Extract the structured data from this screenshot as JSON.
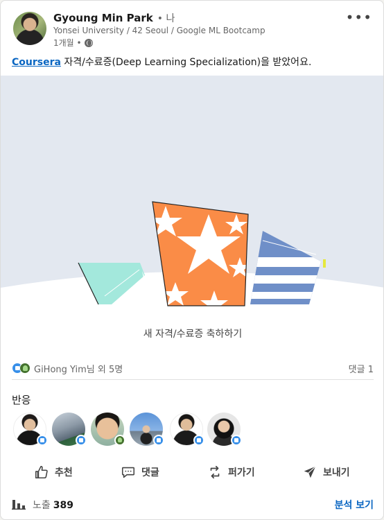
{
  "post": {
    "author": {
      "name": "Gyoung Min Park",
      "degree": "• 나",
      "headline": "Yonsei University / 42 Seoul / Google ML Bootcamp",
      "time": "1개월 •",
      "visibility_icon": "globe-icon"
    },
    "more_icon": "more-horizontal-icon",
    "more_label": "•••",
    "text": {
      "link": "Coursera",
      "rest": " 자격/수료증(Deep Learning Specialization)을 받았어요."
    }
  },
  "banner": {
    "caption": "새 자격/수료증 축하하기",
    "colors": {
      "background": "#e3e8f0",
      "orange": "#fa8c47",
      "teal": "#a3e8dc",
      "blue": "#6f8fc8",
      "yellow": "#e5e83d"
    }
  },
  "social": {
    "names": "GiHong Yim님 외 5명",
    "comments": "댓글 1",
    "icons": [
      "like-icon",
      "celebrate-icon"
    ]
  },
  "reactions": {
    "label": "반응",
    "people": [
      {
        "name": "reactor-1",
        "reaction": "like"
      },
      {
        "name": "reactor-2",
        "reaction": "like"
      },
      {
        "name": "reactor-3",
        "reaction": "celebrate"
      },
      {
        "name": "reactor-4",
        "reaction": "like"
      },
      {
        "name": "reactor-5",
        "reaction": "like"
      },
      {
        "name": "reactor-6",
        "reaction": "like"
      }
    ]
  },
  "actions": {
    "like": "추천",
    "comment": "댓글",
    "repost": "퍼가기",
    "send": "보내기"
  },
  "analytics": {
    "label": "노출",
    "count": "389",
    "link": "분석 보기"
  }
}
